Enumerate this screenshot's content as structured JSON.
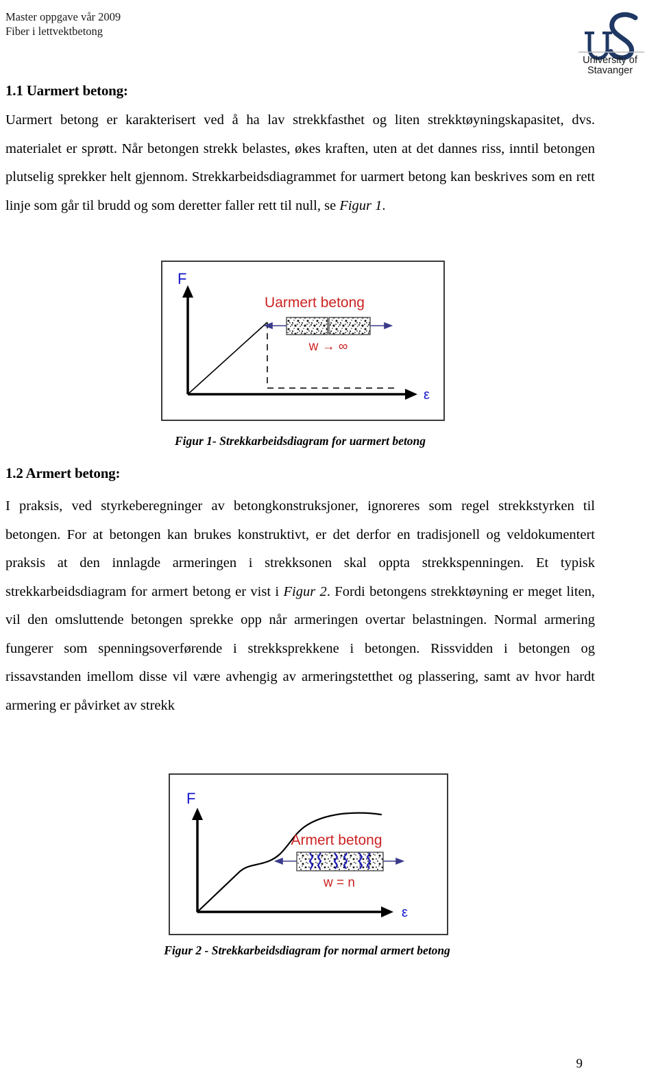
{
  "header": {
    "line1": "Master oppgave vår 2009",
    "line2": "Fiber i lettvektbetong",
    "logo": {
      "monogram": "US",
      "name_line1": "University of",
      "name_line2": "Stavanger",
      "color": "#1f3864"
    }
  },
  "sections": [
    {
      "heading": "1.1 Uarmert betong:",
      "paragraph_parts": [
        {
          "text": "Uarmert betong er karakterisert ved å ha lav strekkfasthet og liten strekktøyningskapasitet, dvs. materialet er sprøtt. Når betongen strekk belastes, økes kraften, uten at det dannes riss, inntil betongen plutselig sprekker helt gjennom. Strekkarbeidsdiagrammet for uarmert betong kan beskrives som en rett linje som går til brudd og som deretter faller rett til null, se ",
          "style": "normal"
        },
        {
          "text": "Figur 1",
          "style": "italic"
        },
        {
          "text": ".",
          "style": "normal"
        }
      ]
    },
    {
      "heading": "1.2 Armert betong:",
      "paragraph_parts": [
        {
          "text": "I praksis, ved styrkeberegninger av betongkonstruksjoner, ignoreres som regel strekkstyrken til betongen. For at betongen kan brukes konstruktivt, er det derfor en tradisjonell og veldokumentert praksis at den innlagde armeringen i strekksonen skal oppta strekkspenningen. Et typisk strekkarbeidsdiagram for armert betong er vist i ",
          "style": "normal"
        },
        {
          "text": "Figur 2",
          "style": "italic"
        },
        {
          "text": ". Fordi betongens strekktøyning er meget liten, vil den omsluttende betongen sprekke opp når armeringen overtar belastningen. Normal armering fungerer som spenningsoverførende i strekksprekkene i betongen. Rissvidden i betongen og rissavstanden imellom disse vil være avhengig av armeringstetthet og plassering, samt av hvor hardt armering er påvirket av strekk",
          "style": "normal"
        }
      ]
    }
  ],
  "figures": [
    {
      "id": "figure-1",
      "caption": "Figur 1- Strekkarbeidsdiagram for uarmert betong",
      "y_axis_label": "F",
      "x_axis_label": "ε",
      "title": "Uarmert betong",
      "annotation": "w → ∞",
      "title_color": "#cc2222",
      "axis_label_color": "#1414cc",
      "arrow_color": "#3a3a8c",
      "curve_description": "straight rising line to peak, then vertical dashed drop to zero and dashed horizontal line"
    },
    {
      "id": "figure-2",
      "caption": "Figur 2 - Strekkarbeidsdiagram for normal armert betong",
      "y_axis_label": "F",
      "x_axis_label": "ε",
      "title": "Armert betong",
      "annotation": "w = n",
      "title_color": "#cc2222",
      "axis_label_color": "#1414cc",
      "arrow_color": "#3a3a8c",
      "crack_color": "#1a1ab4",
      "curve_description": "S-shaped curve: steep rise, knee plateau, second rise, final plateau"
    }
  ],
  "chart_data": [
    {
      "type": "line",
      "title": "Uarmert betong",
      "xlabel": "ε",
      "ylabel": "F",
      "x": [
        0,
        0.62,
        0.62,
        1.0
      ],
      "values": [
        0,
        1.0,
        0,
        0
      ],
      "annotations": [
        "w → ∞"
      ],
      "grid": false,
      "legend": "none"
    },
    {
      "type": "line",
      "title": "Armert betong",
      "xlabel": "ε",
      "ylabel": "F",
      "x": [
        0,
        0.2,
        0.3,
        0.38,
        0.45,
        0.55,
        0.65,
        0.75,
        0.85,
        1.0
      ],
      "values": [
        0,
        0.45,
        0.58,
        0.62,
        0.68,
        0.82,
        0.93,
        0.98,
        1.0,
        0.99
      ],
      "annotations": [
        "w = n"
      ],
      "grid": false,
      "legend": "none"
    }
  ],
  "footer": {
    "page_number": "9"
  }
}
